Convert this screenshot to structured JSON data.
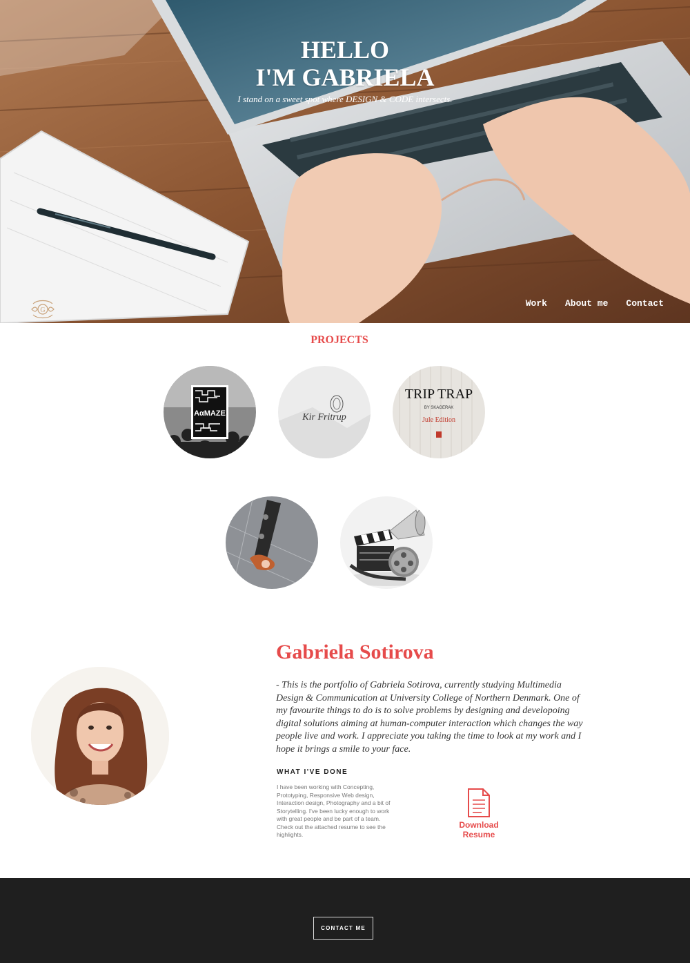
{
  "hero": {
    "title_line1": "HELLO",
    "title_line2": "I'M GABRIELA",
    "subtitle": "I stand on a sweet spot where DESIGN & CODE intersects."
  },
  "logo": {
    "letter": "G"
  },
  "nav": {
    "items": [
      "Work",
      "About me",
      "Contact"
    ]
  },
  "projects": {
    "title": "PROJECTS",
    "items": [
      {
        "label": "AαMAZE"
      },
      {
        "label": "Kir Fritrup"
      },
      {
        "label": "TRIP TRAP",
        "sub": "BY SKAGERAK",
        "edition": "Jule Edition"
      },
      {
        "label": ""
      },
      {
        "label": ""
      }
    ]
  },
  "about": {
    "name": "Gabriela Sotirova",
    "bio": "- This is the portfolio of Gabriela Sotirova, currently studying Multimedia Design & Communication at University College of Northern Denmark. One of my favourite things to do is to solve problems by designing and developoing digital solutions aiming at human-computer interaction which changes the way people live and work. I appreciate you taking the time to look at my work and I hope it brings a smile to your face.",
    "done_title": "WHAT I'VE DONE",
    "done_text": "I have been working with Concepting, Prototyping, Responsive Web design, Interaction design, Photography and a bit of Storytelling. I've been lucky enough to work with great people and be part of a team. Check out the attached resume to see the highlights.",
    "download_line1": "Download",
    "download_line2": "Resume"
  },
  "footer": {
    "contact_button": "CONTACT ME"
  },
  "colors": {
    "accent": "#e64b4b",
    "footer_bg": "#1f1f1f"
  },
  "icons": [
    "ornament-logo-icon",
    "document-icon"
  ]
}
